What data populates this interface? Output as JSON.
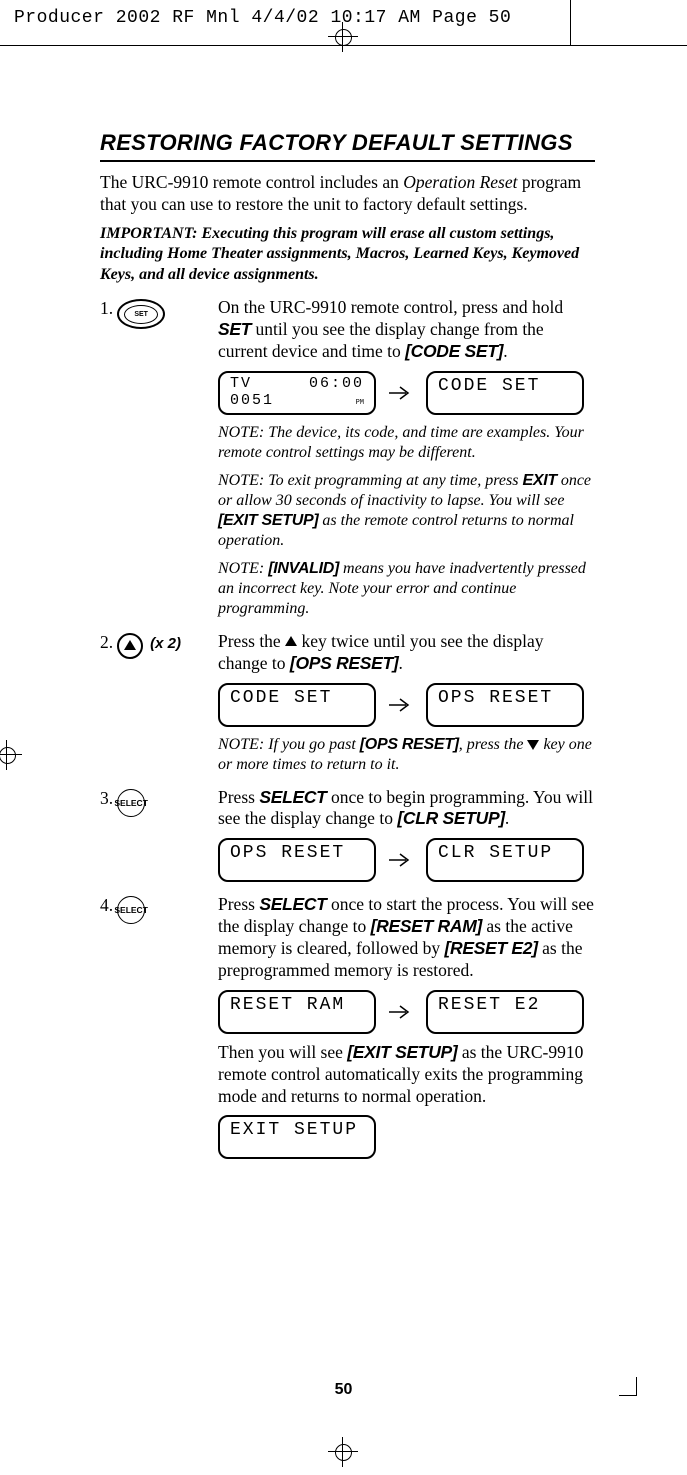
{
  "slug": "Producer 2002 RF Mnl  4/4/02  10:17 AM  Page 50",
  "heading": "RESTORING FACTORY DEFAULT SETTINGS",
  "intro": {
    "p1a": "The URC-9910 remote control includes an ",
    "p1b": "Operation Reset",
    "p1c": " program that you can use to restore the unit to factory default settings.",
    "important": "IMPORTANT: Executing this program will erase all custom settings, including Home Theater assignments, Macros, Learned Keys, Keymoved Keys, and all device assignments."
  },
  "step1": {
    "num": "1.",
    "btn": "SET",
    "t1": "On the URC-9910 remote control, press and hold ",
    "t2": "SET",
    "t3": " until you see the display change from the current device and time to ",
    "t4": "[CODE SET]",
    "t5": ".",
    "lcdA": {
      "top_l": "TV",
      "top_r": "06:00",
      "bot_l": "0051",
      "bot_r": "PM"
    },
    "lcdB": "CODE SET",
    "note1": "NOTE: The device, its code, and time are examples. Your remote control settings may be different.",
    "note2a": "NOTE: To exit programming at any time, press ",
    "note2b": "EXIT",
    "note2c": " once or allow 30 seconds of inactivity to lapse. You will see ",
    "note2d": "[EXIT SETUP]",
    "note2e": " as the remote control returns to normal operation.",
    "note3a": "NOTE: ",
    "note3b": "[INVALID]",
    "note3c": " means you have inadvertently pressed an incorrect key. Note your error and continue programming."
  },
  "step2": {
    "num": "2.",
    "x2": "(x 2)",
    "t1": "Press the ",
    "t2": " key twice until you see the display change to ",
    "t3": "[OPS RESET]",
    "t4": ".",
    "lcdA": "CODE SET",
    "lcdB": "OPS RESET",
    "note1a": "NOTE: If you go past ",
    "note1b": "[OPS RESET]",
    "note1c": ", press the ",
    "note1d": " key one or more times to return to it."
  },
  "step3": {
    "num": "3.",
    "btn": "SELECT",
    "t1": "Press ",
    "t2": "SELECT",
    "t3": " once to begin programming. You will see the display change to ",
    "t4": "[CLR SETUP]",
    "t5": ".",
    "lcdA": "OPS RESET",
    "lcdB": "CLR SETUP"
  },
  "step4": {
    "num": "4.",
    "btn": "SELECT",
    "t1": "Press ",
    "t2": "SELECT",
    "t3": " once to start the process. You will see the display change to ",
    "t4": "[RESET RAM]",
    "t5": " as the active memory is cleared, followed by ",
    "t6": "[RESET E2]",
    "t7": " as the preprogrammed memory is restored.",
    "lcdA": "RESET RAM",
    "lcdB": "RESET E2",
    "p2a": "Then you will see ",
    "p2b": "[EXIT SETUP]",
    "p2c": " as the URC-9910 remote control automatically exits the programming mode and returns to normal operation.",
    "lcdC": "EXIT SETUP"
  },
  "page_num": "50"
}
